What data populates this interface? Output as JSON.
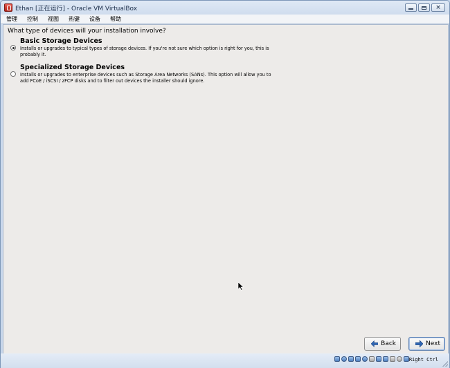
{
  "window": {
    "title": "Ethan [正在运行] - Oracle VM VirtualBox"
  },
  "menubar": {
    "items": [
      "管理",
      "控制",
      "视图",
      "热键",
      "设备",
      "帮助"
    ]
  },
  "installer": {
    "question": "What type of devices will your installation involve?",
    "options": [
      {
        "title": "Basic Storage Devices",
        "description": "Installs or upgrades to typical types of storage devices.  If you're not sure which option is right for you, this is probably it.",
        "selected": true
      },
      {
        "title": "Specialized Storage Devices",
        "description": "Installs or upgrades to enterprise devices such as Storage Area Networks (SANs). This option will allow you to add FCoE / iSCSI / zFCP disks and to filter out devices the installer should ignore.",
        "selected": false
      }
    ],
    "back_label": "Back",
    "next_label": "Next"
  },
  "statusbar": {
    "host_key": "Right Ctrl",
    "icons": [
      "hard-disk-icon",
      "optical-drive-icon",
      "audio-icon",
      "network-icon",
      "usb-icon",
      "shared-folder-icon",
      "display-icon",
      "video-capture-icon",
      "cpu-icon",
      "mouse-integration-icon",
      "keyboard-icon"
    ]
  },
  "colors": {
    "title_bar": "#cfdcee",
    "vm_background": "#edebe9",
    "accent_arrow": "#2f66b3"
  }
}
